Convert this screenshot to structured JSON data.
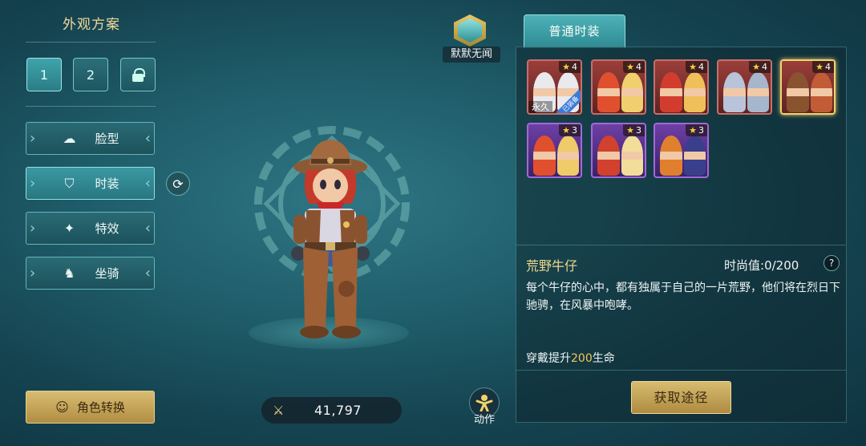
{
  "left": {
    "title": "外观方案",
    "schemes": [
      "1",
      "2"
    ],
    "locked_scheme_icon": "lock-icon",
    "menu": [
      {
        "label": "脸型",
        "icon": "face-icon"
      },
      {
        "label": "时装",
        "icon": "outfit-icon"
      },
      {
        "label": "特效",
        "icon": "sparkle-icon"
      },
      {
        "label": "坐骑",
        "icon": "mount-icon"
      }
    ],
    "role_switch_label": "角色转换"
  },
  "center": {
    "player_name": "默默无闻",
    "power_value": "41,797",
    "action_label": "动作"
  },
  "right": {
    "tab_label": "普通时装",
    "cards": [
      {
        "stars": "4",
        "rarity": "red",
        "tag": "永久",
        "owned_tag": "已装备",
        "colors": [
          "#e9e9ee",
          "#e9e9ee"
        ]
      },
      {
        "stars": "4",
        "rarity": "red",
        "colors": [
          "#e0502e",
          "#f0cf6e"
        ]
      },
      {
        "stars": "4",
        "rarity": "red",
        "colors": [
          "#d23c2e",
          "#efc05a"
        ]
      },
      {
        "stars": "4",
        "rarity": "red",
        "colors": [
          "#b9c3d9",
          "#a6b6cc"
        ]
      },
      {
        "stars": "4",
        "rarity": "red",
        "selected": true,
        "colors": [
          "#8a5330",
          "#c25c36"
        ]
      },
      {
        "stars": "3",
        "rarity": "purple",
        "colors": [
          "#e0502e",
          "#efcb6a"
        ]
      },
      {
        "stars": "3",
        "rarity": "purple",
        "colors": [
          "#d2402e",
          "#f2dd9a"
        ]
      },
      {
        "stars": "3",
        "rarity": "purple",
        "colors": [
          "#e0802e",
          "#3a3f8c"
        ]
      }
    ],
    "item_name": "荒野牛仔",
    "fashion_label": "时尚值:",
    "fashion_value": "0/200",
    "help": "?",
    "description": "每个牛仔的心中，都有独属于自己的一片荒野，他们将在烈日下驰骋，在风暴中咆哮。",
    "bonus_prefix": "穿戴提升",
    "bonus_value": "200",
    "bonus_suffix": "生命",
    "obtain_label": "获取途径"
  }
}
